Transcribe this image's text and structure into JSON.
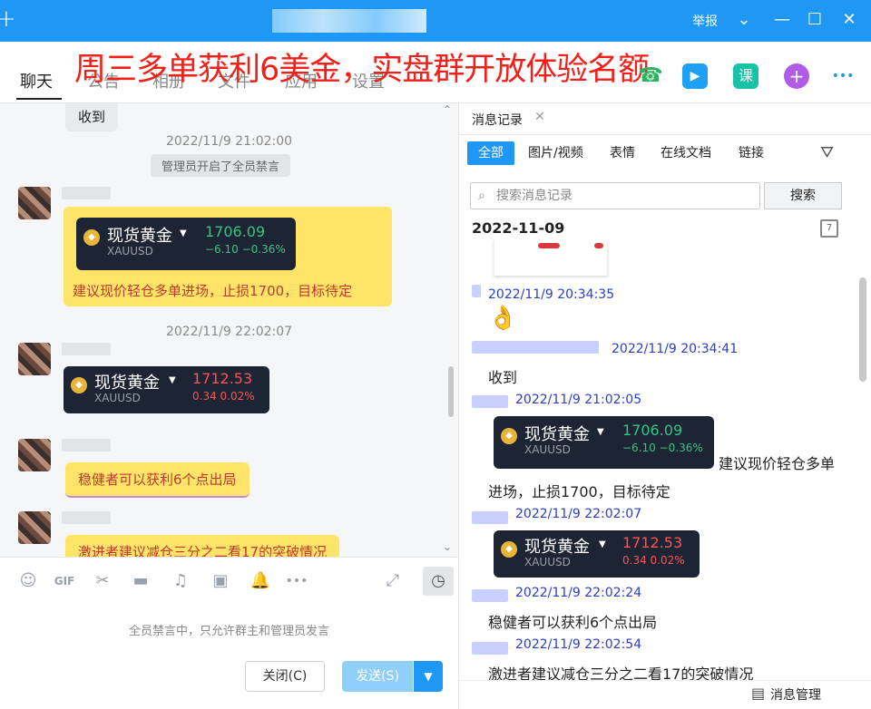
{
  "titlebar": {
    "report": "举报",
    "icons": [
      "plus-icon",
      "chevron-down-icon",
      "skin-icon",
      "maximize-icon",
      "close-icon"
    ]
  },
  "promo_text": "周三多单获利6美金，实盘群开放体验名额",
  "nav": {
    "tabs": [
      "聊天",
      "公告",
      "相册",
      "文件",
      "应用",
      "设置"
    ],
    "active": "聊天",
    "tool_icons": [
      "call-icon",
      "video-icon",
      "course-icon",
      "add-icon",
      "more-icon"
    ],
    "course_label": "课",
    "add_label": "+",
    "more_label": "•••"
  },
  "chat": {
    "first_msg": "收到",
    "ts1": "2022/11/9 21:02:00",
    "sys_msg": "管理员开启了全员禁言",
    "card1": {
      "name": "现货黄金",
      "symbol": "XAUUSD",
      "price": "1706.09",
      "change": "−6.10  −0.36%"
    },
    "msg1": "建议现价轻仓多单进场，止损1700，目标待定",
    "ts2": "2022/11/9 22:02:07",
    "card2": {
      "name": "现货黄金",
      "symbol": "XAUUSD",
      "price": "1712.53",
      "change": "0.34   0.02%"
    },
    "msg2": "稳健者可以获利6个点出局",
    "msg3": "激进者建议减仓三分之二看17的突破情况"
  },
  "input": {
    "ban_note": "全员禁言中，只允许群主和管理员发言",
    "close_label": "关闭(C)",
    "send_label": "发送(S)",
    "gif_label": "GIF",
    "icons": [
      "emoji-icon",
      "gif-icon",
      "scissors-icon",
      "folder-icon",
      "music-icon",
      "image-icon",
      "bell-icon",
      "more-icon",
      "expand-icon",
      "clock-icon"
    ]
  },
  "history": {
    "tab_label": "消息记录",
    "filters": [
      "全部",
      "图片/视频",
      "表情",
      "在线文档",
      "链接"
    ],
    "search_placeholder": "搜索消息记录",
    "search_button": "搜索",
    "date_heading": "2022-11-09",
    "calendar_day": "7",
    "entries": [
      {
        "ts": "2022/11/9 20:34:35",
        "content": "👌"
      },
      {
        "ts": "2022/11/9 20:34:41",
        "content": "收到"
      },
      {
        "ts": "2022/11/9 21:02:05",
        "content": "建议现价轻仓多单"
      },
      {
        "content": "进场，止损1700，目标待定"
      },
      {
        "ts": "2022/11/9 22:02:07"
      },
      {
        "ts": "2022/11/9 22:02:24",
        "content": "稳健者可以获利6个点出局"
      },
      {
        "ts": "2022/11/9 22:02:54",
        "content": "激进者建议减仓三分之二看17的突破情况"
      }
    ],
    "card1": {
      "name": "现货黄金",
      "symbol": "XAUUSD",
      "price": "1706.09",
      "change": "−6.10  −0.36%"
    },
    "card2": {
      "name": "现货黄金",
      "symbol": "XAUUSD",
      "price": "1712.53",
      "change": "0.34   0.02%"
    },
    "msg_manager": "消息管理"
  }
}
